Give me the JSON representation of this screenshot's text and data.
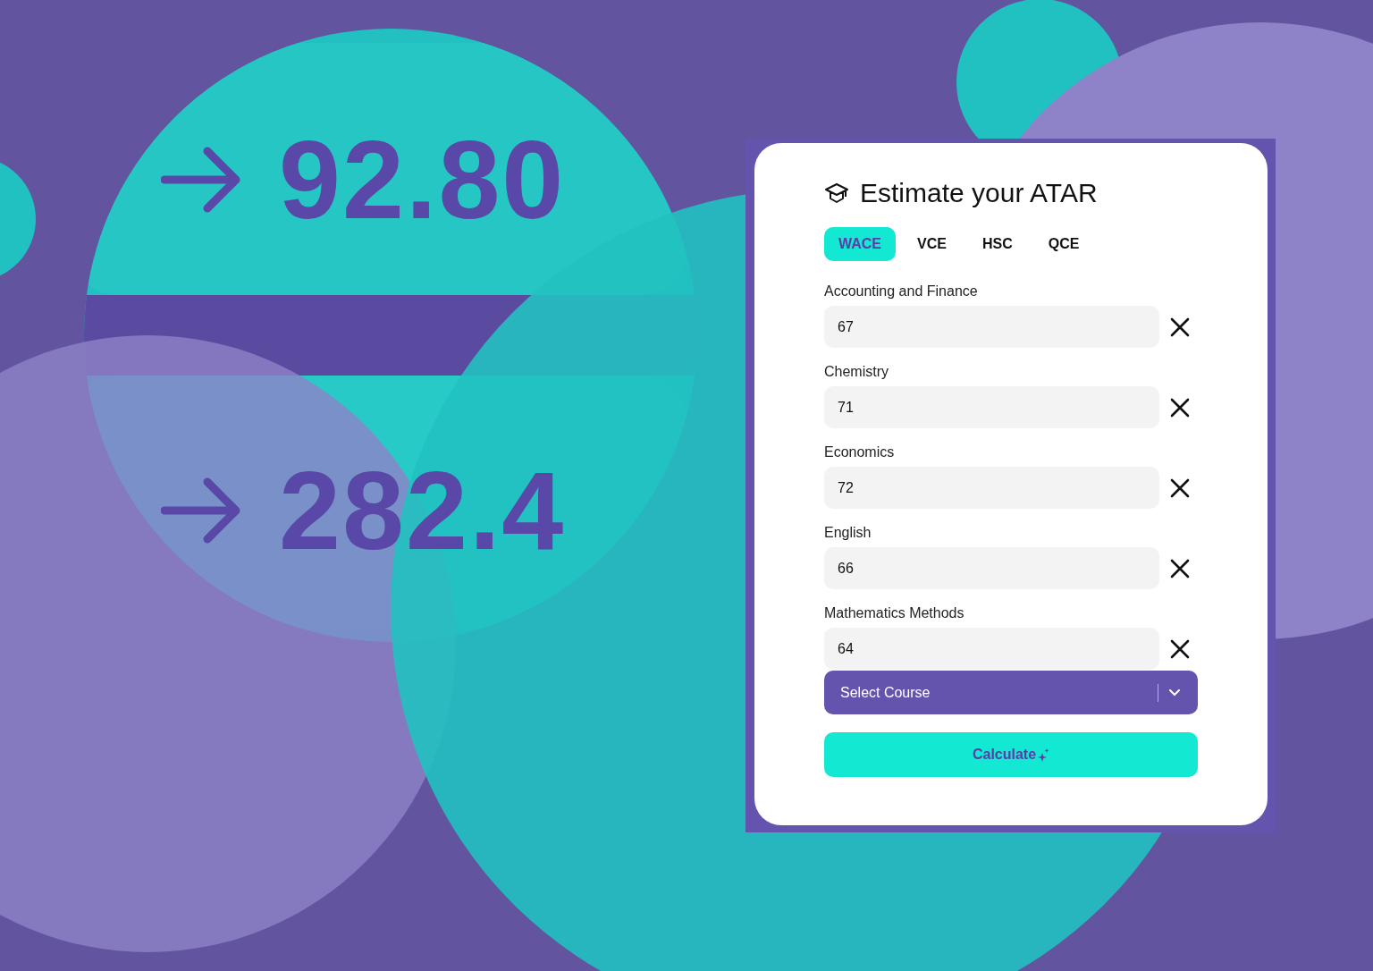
{
  "hero_numbers": [
    "92.80",
    "282.4"
  ],
  "card": {
    "title": "Estimate your ATAR",
    "tabs": [
      {
        "label": "WACE",
        "selected": true
      },
      {
        "label": "VCE",
        "selected": false
      },
      {
        "label": "HSC",
        "selected": false
      },
      {
        "label": "QCE",
        "selected": false
      }
    ],
    "subjects": [
      {
        "name": "Accounting and Finance",
        "score": "67"
      },
      {
        "name": "Chemistry",
        "score": "71"
      },
      {
        "name": "Economics",
        "score": "72"
      },
      {
        "name": "English",
        "score": "66"
      },
      {
        "name": "Mathematics Methods",
        "score": "64"
      }
    ],
    "course_select": {
      "placeholder": "Select Course"
    },
    "calculate_button": "Calculate"
  }
}
